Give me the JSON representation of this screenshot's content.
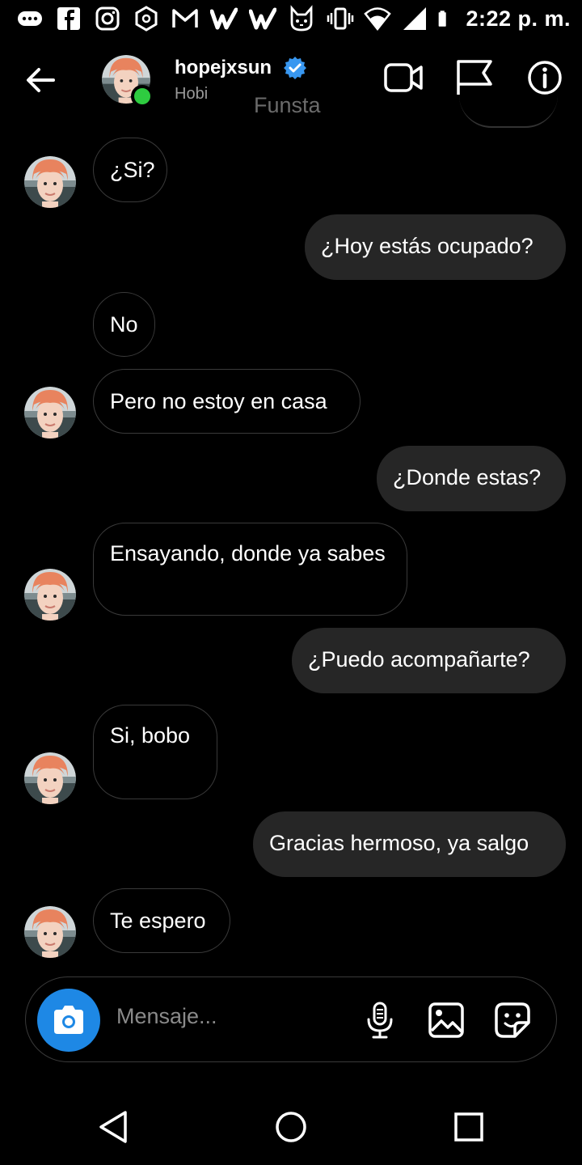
{
  "status_bar": {
    "time": "2:22 p. m.",
    "icons_left": [
      "messages-icon",
      "facebook-icon",
      "instagram-icon",
      "hexagon-app-icon",
      "gmail-icon",
      "wattpad-icon",
      "wattpad-icon",
      "cat-app-icon"
    ],
    "icons_right": [
      "vibrate-icon",
      "wifi-icon",
      "signal-icon",
      "battery-icon"
    ]
  },
  "header": {
    "username": "hopejxsun",
    "display_name": "Hobi",
    "verified": true,
    "online": true,
    "overlay_text": "Funsta"
  },
  "messages": [
    {
      "side": "in",
      "text": "¿Si?",
      "avatar": true
    },
    {
      "side": "out",
      "text": "¿Hoy estás ocupado?"
    },
    {
      "side": "in",
      "text": "No",
      "avatar": false
    },
    {
      "side": "in",
      "text": "Pero no estoy en casa",
      "avatar": true
    },
    {
      "side": "out",
      "text": "¿Donde estas?"
    },
    {
      "side": "in",
      "text": "Ensayando, donde ya sabes",
      "avatar": true
    },
    {
      "side": "out",
      "text": "¿Puedo acompañarte?"
    },
    {
      "side": "in",
      "text": "Si, bobo",
      "avatar": true
    },
    {
      "side": "out",
      "text": "Gracias hermoso, ya salgo"
    },
    {
      "side": "in",
      "text": "Te espero",
      "avatar": true
    }
  ],
  "composer": {
    "placeholder": "Mensaje..."
  },
  "colors": {
    "background": "#000000",
    "outgoing_bubble": "#262626",
    "incoming_border": "#3a3a3a",
    "camera_button": "#1e88e5",
    "online_dot": "#2ecc40",
    "verified_badge": "#3897f0"
  }
}
